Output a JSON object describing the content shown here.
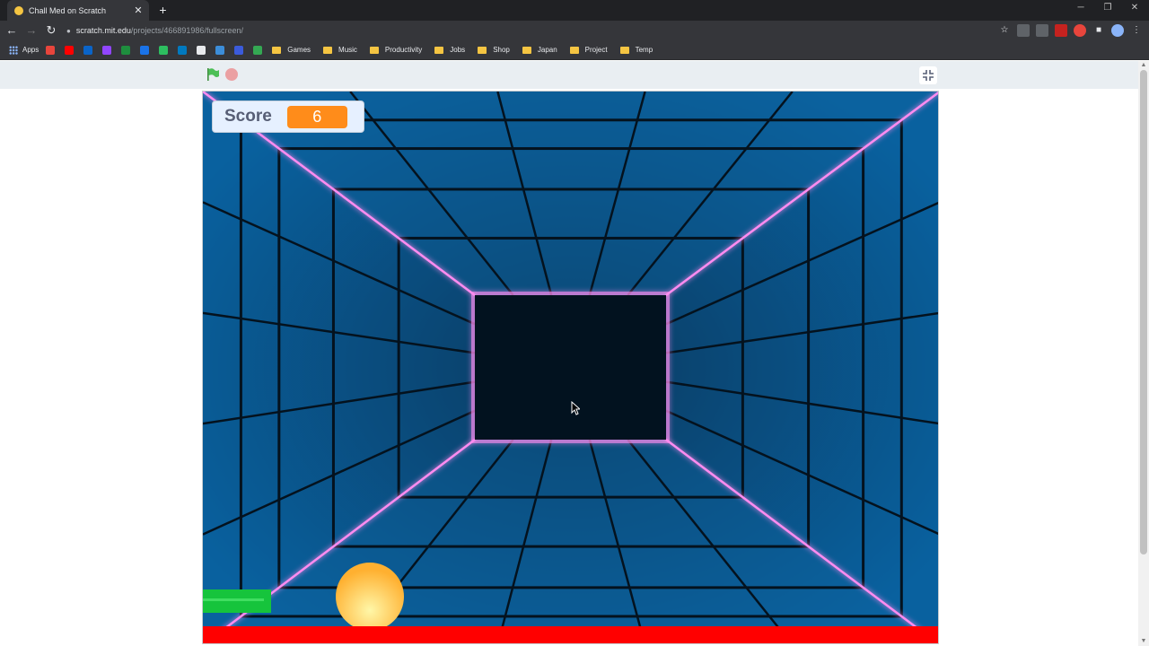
{
  "browser": {
    "tab": {
      "title": "Chall Med on Scratch",
      "close_symbol": "✕"
    },
    "new_tab_symbol": "+",
    "window_controls": {
      "minimize": "─",
      "restore": "❐",
      "close": "✕"
    },
    "nav": {
      "back": "←",
      "forward": "→",
      "reload": "↻"
    },
    "address": {
      "host": "scratch.mit.edu",
      "path": "/projects/466891986/fullscreen/"
    },
    "bookmarks": {
      "apps_label": "Apps",
      "icons": [
        {
          "name": "red-circle-icon",
          "color": "#e8453c"
        },
        {
          "name": "youtube-icon",
          "color": "#ff0000"
        },
        {
          "name": "outlook-icon",
          "color": "#0a64c8"
        },
        {
          "name": "twitch-icon",
          "color": "#9146ff"
        },
        {
          "name": "spreadsheet-icon",
          "color": "#1e8e3e"
        },
        {
          "name": "c-icon",
          "color": "#1a73e8"
        },
        {
          "name": "evernote-icon",
          "color": "#2dbe60"
        },
        {
          "name": "trello-icon",
          "color": "#0079bf"
        },
        {
          "name": "github-icon",
          "color": "#e8eaed"
        },
        {
          "name": "vscode-icon",
          "color": "#3c8dd9"
        },
        {
          "name": "blue-bar-icon",
          "color": "#3b5bdb"
        },
        {
          "name": "star-icon",
          "color": "#34a853"
        }
      ],
      "folders": [
        "Games",
        "Music",
        "Productivity",
        "Jobs",
        "Shop",
        "Japan",
        "Project",
        "Temp"
      ]
    }
  },
  "game": {
    "score_label": "Score",
    "score_value": "6",
    "colors": {
      "tunnel_blue": "#0a66a8",
      "back_wall": "#02121f",
      "neon_pink": "#ff8cf0",
      "paddle": "#16c43c",
      "ball": "#ffc43a",
      "floor_bar": "#ff0000",
      "score_badge": "#ff8c1a"
    }
  }
}
